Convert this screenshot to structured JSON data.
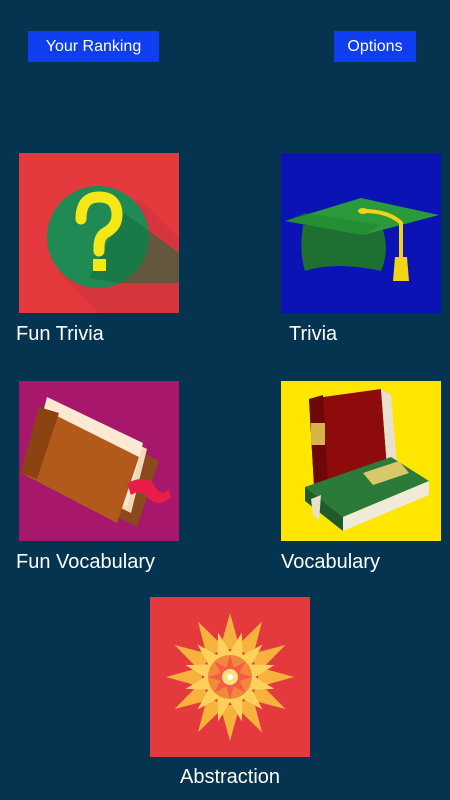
{
  "header": {
    "ranking_label": "Your Ranking",
    "options_label": "Options"
  },
  "categories": [
    {
      "label": "Fun Trivia",
      "icon": "question-mark-icon",
      "bg": "#e43a3e"
    },
    {
      "label": "Trivia",
      "icon": "graduation-cap-icon",
      "bg": "#0b13b4"
    },
    {
      "label": "Fun Vocabulary",
      "icon": "book-icon",
      "bg": "#a7176b"
    },
    {
      "label": "Vocabulary",
      "icon": "books-icon",
      "bg": "#ffe600"
    },
    {
      "label": "Abstraction",
      "icon": "mandala-flower-icon",
      "bg": "#e43a3e"
    }
  ],
  "colors": {
    "background": "#043450",
    "button": "#0f3df0",
    "text": "#ffffff"
  }
}
